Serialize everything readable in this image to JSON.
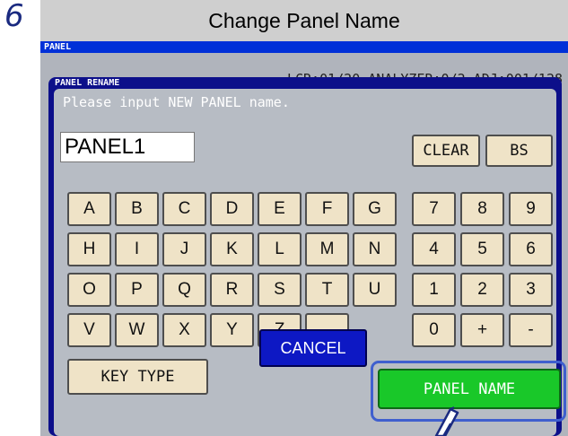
{
  "step": {
    "number": "6"
  },
  "title": "Change Panel Name",
  "background": {
    "header": "PANEL",
    "status": "LCR:01/20  ANALYZER:0/2  ADJ:001/128"
  },
  "dialog": {
    "title": "PANEL RENAME",
    "prompt": "Please input NEW PANEL name.",
    "name_value": "PANEL1",
    "clear_label": "CLEAR",
    "bs_label": "BS",
    "letter_rows": [
      [
        "A",
        "B",
        "C",
        "D",
        "E",
        "F",
        "G"
      ],
      [
        "H",
        "I",
        "J",
        "K",
        "L",
        "M",
        "N"
      ],
      [
        "O",
        "P",
        "Q",
        "R",
        "S",
        "T",
        "U"
      ],
      [
        "V",
        "W",
        "X",
        "Y",
        "Z",
        "_"
      ]
    ],
    "number_rows": [
      [
        "7",
        "8",
        "9"
      ],
      [
        "4",
        "5",
        "6"
      ],
      [
        "1",
        "2",
        "3"
      ],
      [
        "0",
        "+",
        "-"
      ]
    ],
    "key_type_label": "KEY TYPE",
    "cancel_label": "CANCEL",
    "panel_name_label": "PANEL NAME"
  },
  "colors": {
    "accent_blue": "#0c0f8a",
    "confirm_green": "#19c829",
    "key_beige": "#efe3c7",
    "highlight": "#3f5fce"
  },
  "icons": {
    "pointer": "stylus-pen-icon"
  }
}
